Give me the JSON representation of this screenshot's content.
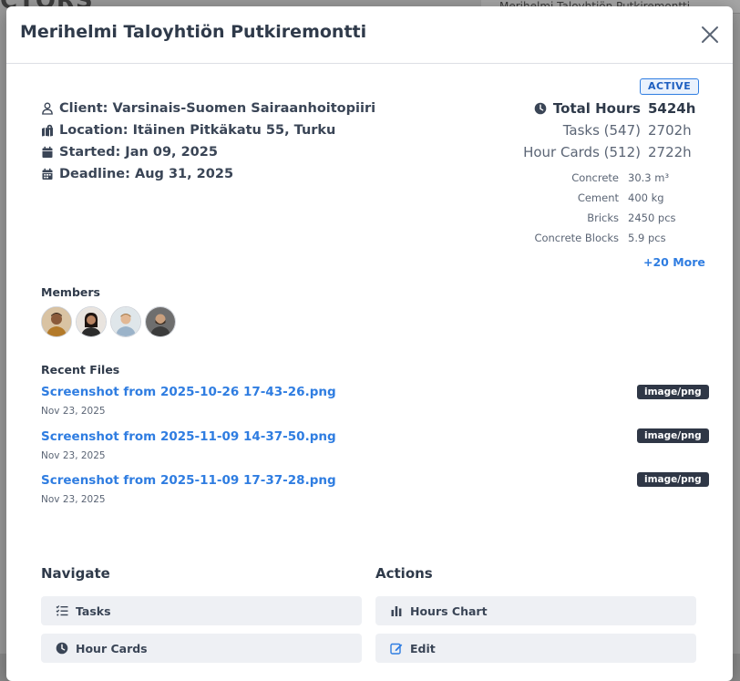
{
  "background": {
    "title_fragment": "CTORS",
    "right_header_fragment": "Merihelmi Taloyhtiön Putkiremontti"
  },
  "modal": {
    "title": "Merihelmi Taloyhtiön Putkiremontti",
    "status": "ACTIVE",
    "details": {
      "client": "Client: Varsinais-Suomen Sairaanhoitopiiri",
      "location": "Location: Itäinen Pitkäkatu 55, Turku",
      "started": "Started: Jan 09, 2025",
      "deadline": "Deadline: Aug 31, 2025"
    },
    "stats": {
      "total_hours_label": "Total Hours",
      "total_hours_value": "5424h",
      "tasks_label": "Tasks (547)",
      "tasks_value": "2702h",
      "hour_cards_label": "Hour Cards (512)",
      "hour_cards_value": "2722h"
    },
    "materials": [
      {
        "name": "Concrete",
        "amount": "30.3 m³"
      },
      {
        "name": "Cement",
        "amount": "400 kg"
      },
      {
        "name": "Bricks",
        "amount": "2450 pcs"
      },
      {
        "name": "Concrete Blocks",
        "amount": "5.9 pcs"
      }
    ],
    "more_materials": "+20 More",
    "members_label": "Members",
    "recent_files_label": "Recent Files",
    "files": [
      {
        "name": "Screenshot from 2025-10-26 17-43-26.png",
        "date": "Nov 23, 2025",
        "type": "image/png"
      },
      {
        "name": "Screenshot from 2025-11-09 14-37-50.png",
        "date": "Nov 23, 2025",
        "type": "image/png"
      },
      {
        "name": "Screenshot from 2025-11-09 17-37-28.png",
        "date": "Nov 23, 2025",
        "type": "image/png"
      }
    ],
    "navigate": {
      "heading": "Navigate",
      "tasks": "Tasks",
      "hour_cards": "Hour Cards"
    },
    "actions": {
      "heading": "Actions",
      "hours_chart": "Hours Chart",
      "edit": "Edit"
    }
  },
  "colors": {
    "accent": "#2f7de1",
    "badge_dark": "#2f3746",
    "button_bg": "#eef0f4"
  }
}
